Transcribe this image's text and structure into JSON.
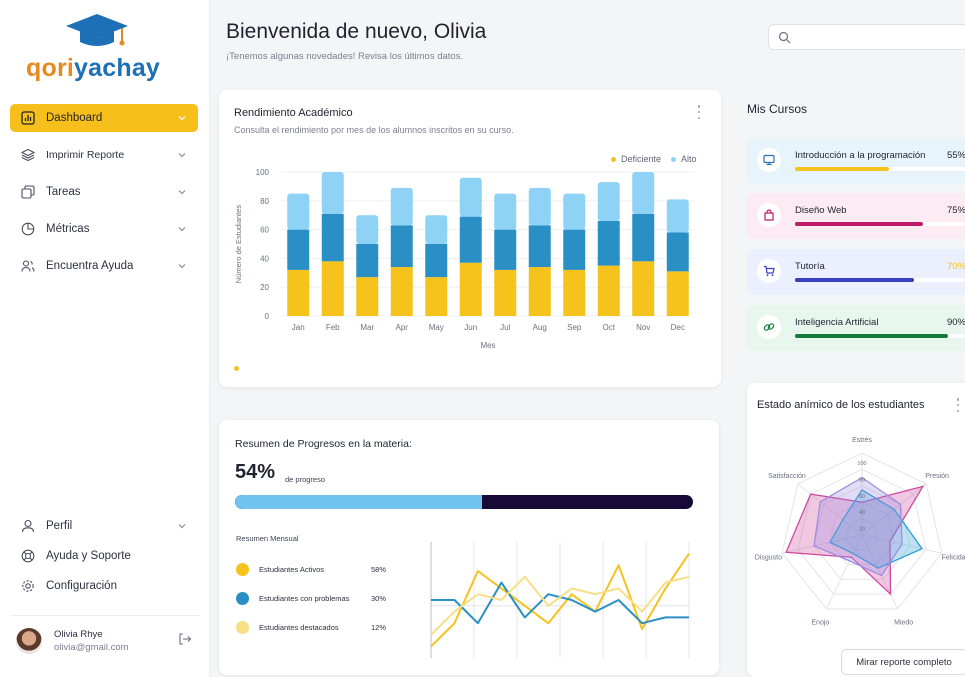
{
  "brand": {
    "part1": "qori",
    "part2": "yachay"
  },
  "nav": {
    "items": [
      {
        "label": "Dashboard",
        "icon": "chart-icon",
        "active": true
      },
      {
        "label": "Imprimir Reporte",
        "icon": "layers-icon",
        "active": false
      },
      {
        "label": "Tareas",
        "icon": "copy-icon",
        "active": false
      },
      {
        "label": "Métricas",
        "icon": "pie-icon",
        "active": false
      },
      {
        "label": "Encuentra Ayuda",
        "icon": "users-icon",
        "active": false
      }
    ],
    "bottom": [
      {
        "label": "Perfil",
        "icon": "user-icon"
      },
      {
        "label": "Ayuda y Soporte",
        "icon": "lifebuoy-icon"
      },
      {
        "label": "Configuración",
        "icon": "gear-icon"
      }
    ]
  },
  "user": {
    "name": "Olivia Rhye",
    "email": "olivia@gmail.com"
  },
  "header": {
    "greeting": "Bienvenida de nuevo, Olivia",
    "subtitle": "¡Tenemos algunas novedades! Revisa los últimos datos.",
    "search_placeholder": ""
  },
  "performance": {
    "title": "Rendimiento Académico",
    "subtitle": "Consulta el rendimiento por mes de los alumnos inscritos en su curso.",
    "legend": [
      "Deficiente",
      "Alto"
    ]
  },
  "chart_data": {
    "type": "bar",
    "stacked": true,
    "categories": [
      "Jan",
      "Feb",
      "Mar",
      "Apr",
      "May",
      "Jun",
      "Jul",
      "Aug",
      "Sep",
      "Oct",
      "Nov",
      "Dec"
    ],
    "series": [
      {
        "name": "Deficiente",
        "values": [
          32,
          38,
          27,
          34,
          27,
          37,
          32,
          34,
          32,
          35,
          38,
          31
        ]
      },
      {
        "values": [
          28,
          33,
          23,
          29,
          23,
          32,
          28,
          29,
          28,
          31,
          33,
          27
        ]
      },
      {
        "name": "Alto",
        "values": [
          25,
          29,
          20,
          26,
          20,
          27,
          25,
          26,
          25,
          27,
          29,
          23
        ]
      }
    ],
    "colors": [
      "#f6c21c",
      "#2a8fc4",
      "#8ed2f6"
    ],
    "xlabel": "Mes",
    "ylabel": "Número de Estudiantes",
    "ylim": [
      0,
      100
    ],
    "yticks": [
      0,
      20,
      40,
      60,
      80,
      100
    ]
  },
  "progress": {
    "title": "Resumen de Progresos en la materia:",
    "value": "54%",
    "value_label": "de progreso",
    "fraction": 0.54,
    "summary_title": "Resumen Mensual",
    "rows": [
      {
        "label": "Estudiantes Activos",
        "value": "58%",
        "color": "#f6c21c"
      },
      {
        "label": "Estudiantes con problemas",
        "value": "30%",
        "color": "#2a8fc4"
      },
      {
        "label": "Estudiantes destacados",
        "value": "12%",
        "color": "#f8de86"
      }
    ],
    "lines": [
      {
        "color": "#f6c21c",
        "values": [
          10,
          30,
          75,
          60,
          45,
          30,
          55,
          40,
          80,
          25,
          60,
          90
        ]
      },
      {
        "color": "#2a8fc4",
        "values": [
          50,
          50,
          30,
          65,
          35,
          55,
          50,
          40,
          50,
          30,
          35,
          35
        ]
      },
      {
        "color": "#f8de86",
        "values": [
          20,
          40,
          55,
          50,
          70,
          45,
          60,
          55,
          60,
          40,
          65,
          70
        ]
      }
    ]
  },
  "courses": {
    "title": "Mis Cursos",
    "items": [
      {
        "name": "Introducción a la programación",
        "pct": "55%",
        "value": 0.55,
        "bg": "#e8f4fc",
        "bar": "#f6c21c",
        "icon": "monitor-icon",
        "icon_color": "#2a6fb6",
        "pct_color": "#1f2330"
      },
      {
        "name": "Diseño Web",
        "pct": "75%",
        "value": 0.75,
        "bg": "#fdebf3",
        "bar": "#c01a6a",
        "icon": "bag-icon",
        "icon_color": "#c01a6a",
        "pct_color": "#1f2330"
      },
      {
        "name": "Tutoría",
        "pct": "70%",
        "value": 0.7,
        "bg": "#eceffd",
        "bar": "#3b3fbf",
        "icon": "cart-icon",
        "icon_color": "#3b3fbf",
        "pct_color": "#f6c21c"
      },
      {
        "name": "Inteligencia Artificial",
        "pct": "90%",
        "value": 0.9,
        "bg": "#e8f7ee",
        "bar": "#137a3a",
        "icon": "link-icon",
        "icon_color": "#137a3a",
        "pct_color": "#1f2330"
      }
    ]
  },
  "mood": {
    "title": "Estado anímico de los estudiantes",
    "axes": [
      "Estrés",
      "Presión",
      "Felicidad",
      "Miedo",
      "Enojo",
      "Disgusto",
      "Satisfacción"
    ],
    "ticks": [
      "100",
      "80",
      "60",
      "40",
      "20"
    ],
    "series": [
      {
        "color": "#d04aa0",
        "values": [
          40,
          95,
          35,
          80,
          30,
          95,
          80
        ]
      },
      {
        "color": "#2a9fd6",
        "values": [
          55,
          50,
          75,
          45,
          25,
          40,
          30
        ]
      },
      {
        "color": "#9b8fe0",
        "values": [
          70,
          60,
          50,
          55,
          35,
          60,
          65
        ]
      }
    ],
    "button": "Mirar reporte completo"
  }
}
